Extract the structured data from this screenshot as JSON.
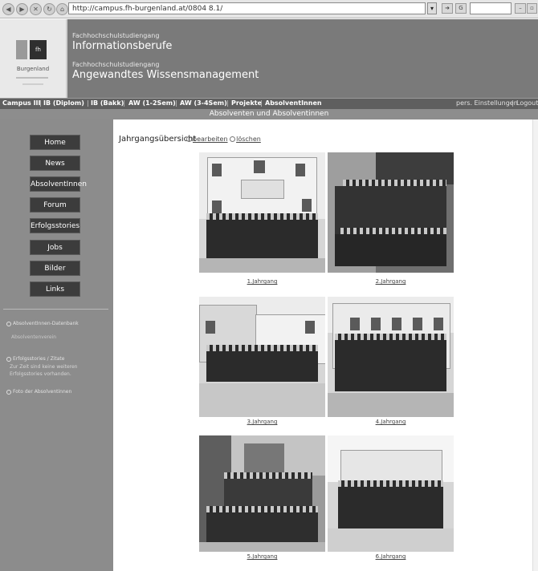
{
  "browser": {
    "url": "http://campus.fh-burgenland.at/0804 8.1/",
    "search_placeholder": "",
    "nav_icons": [
      "back-icon",
      "forward-icon",
      "stop-icon",
      "refresh-icon",
      "home-icon"
    ]
  },
  "header": {
    "logo_text": "Burgenland",
    "line1_small": "Fachhochschulstudiengang",
    "line1_big": "Informationsberufe",
    "line2_small": "Fachhochschulstudiengang",
    "line2_big": "Angewandtes Wissensmanagement"
  },
  "topnav": {
    "items": [
      "Campus III",
      "IB (Diplom)",
      "IB (Bakk)",
      "AW (1-2Sem)",
      "AW (3-4Sem)",
      "Projekte",
      "AbsolventInnen"
    ],
    "right_items": [
      "pers. Einstellungen",
      "Logout"
    ]
  },
  "subheader": {
    "title": "Absolventen und Absolventinnen"
  },
  "sidebar": {
    "buttons": [
      "Home",
      "News",
      "AbsolventInnen",
      "Forum",
      "Erfolgsstories",
      "Jobs",
      "Bilder",
      "Links"
    ],
    "link1": "AbsolventInnen-Datenbank",
    "link2": "Absolventenverein",
    "info_title": "Erfolgsstories / Zitate",
    "info_text": "Zur Zeit sind keine weiteren Erfolgsstories vorhanden.",
    "link3": "Foto der Absolventinnen"
  },
  "main": {
    "page_title": "Jahrgangsübersicht",
    "action_edit": "bearbeiten",
    "action_delete": "löschen",
    "photos": [
      {
        "caption": "1.Jahrgang"
      },
      {
        "caption": "2.Jahrgang"
      },
      {
        "caption": "3.Jahrgang"
      },
      {
        "caption": "4.Jahrgang"
      },
      {
        "caption": "5.Jahrgang"
      },
      {
        "caption": "6.Jahrgang"
      }
    ]
  }
}
